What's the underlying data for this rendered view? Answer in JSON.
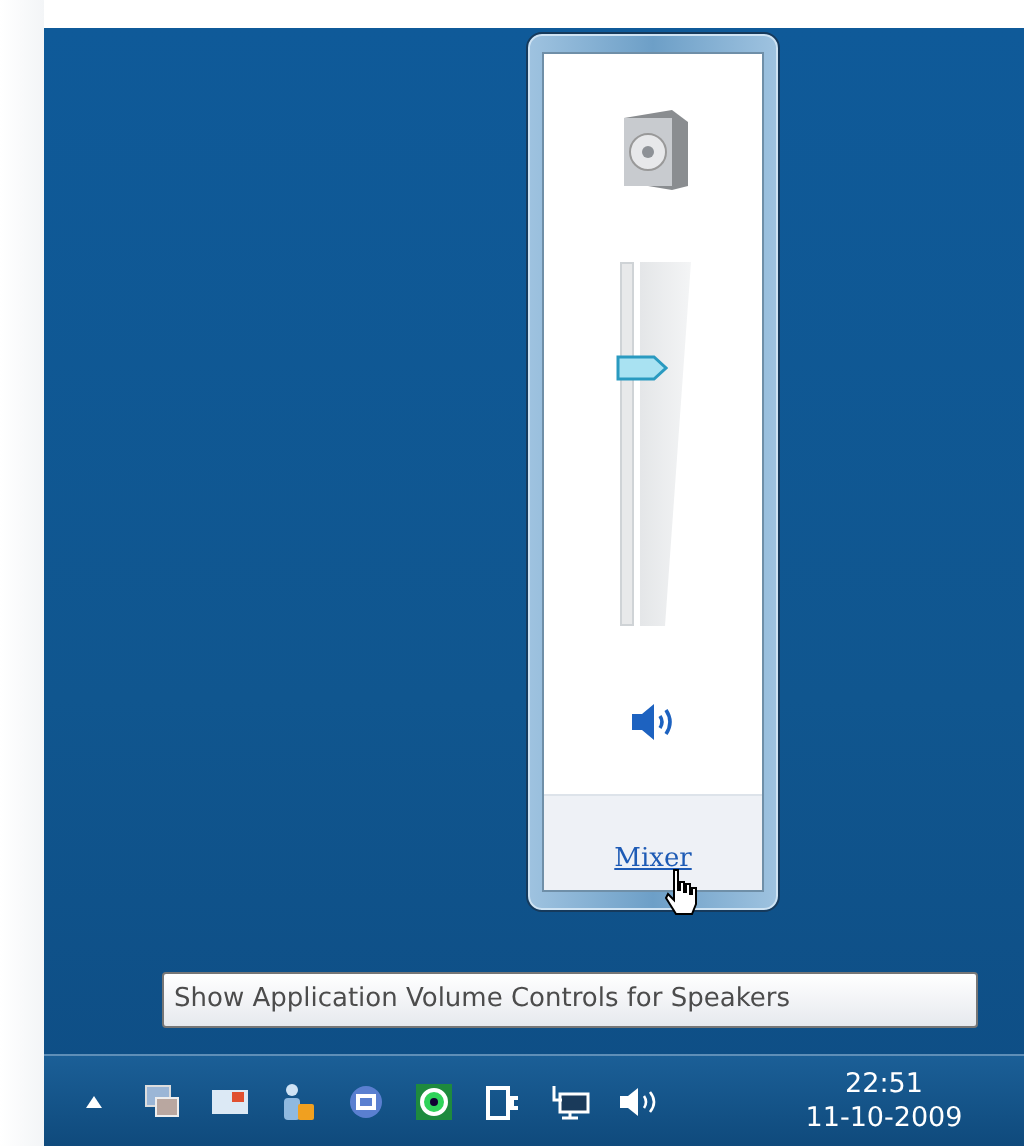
{
  "volume_popup": {
    "level": 0.71,
    "mixer_link": "Mixer"
  },
  "tooltip": "Show Application Volume Controls for Speakers",
  "taskbar": {
    "clock_time": "22:51",
    "clock_date": "11-10-2009"
  }
}
